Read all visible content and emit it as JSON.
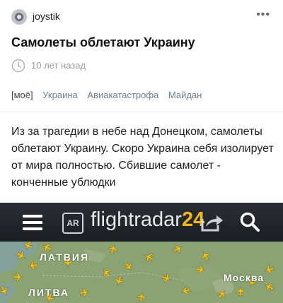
{
  "post": {
    "author": "joystik",
    "more_label": "•••",
    "title": "Самолеты облетают Украину",
    "time": "10 лет назад",
    "tags": [
      "[моё]",
      "Украина",
      "Авиакатастрофа",
      "Майдан"
    ],
    "body": "Из за трагедии в небе над Донецком, самолеты облетают Украину. Скоро Украина себя изолирует от мира полностью. Сбившие самолет - конченные ублюдки"
  },
  "flightradar": {
    "ar_label": "AR",
    "logo_text": "flightradar",
    "logo_number": "24",
    "map_labels": {
      "latvia": "ЛАТВИЯ",
      "lithuania": "ЛИТВА",
      "moscow": "Москва"
    },
    "colors": {
      "bar": "#23272c",
      "map": "#8aa274",
      "plane": "#f4c21c",
      "logo_number": "#f6b61e"
    }
  }
}
